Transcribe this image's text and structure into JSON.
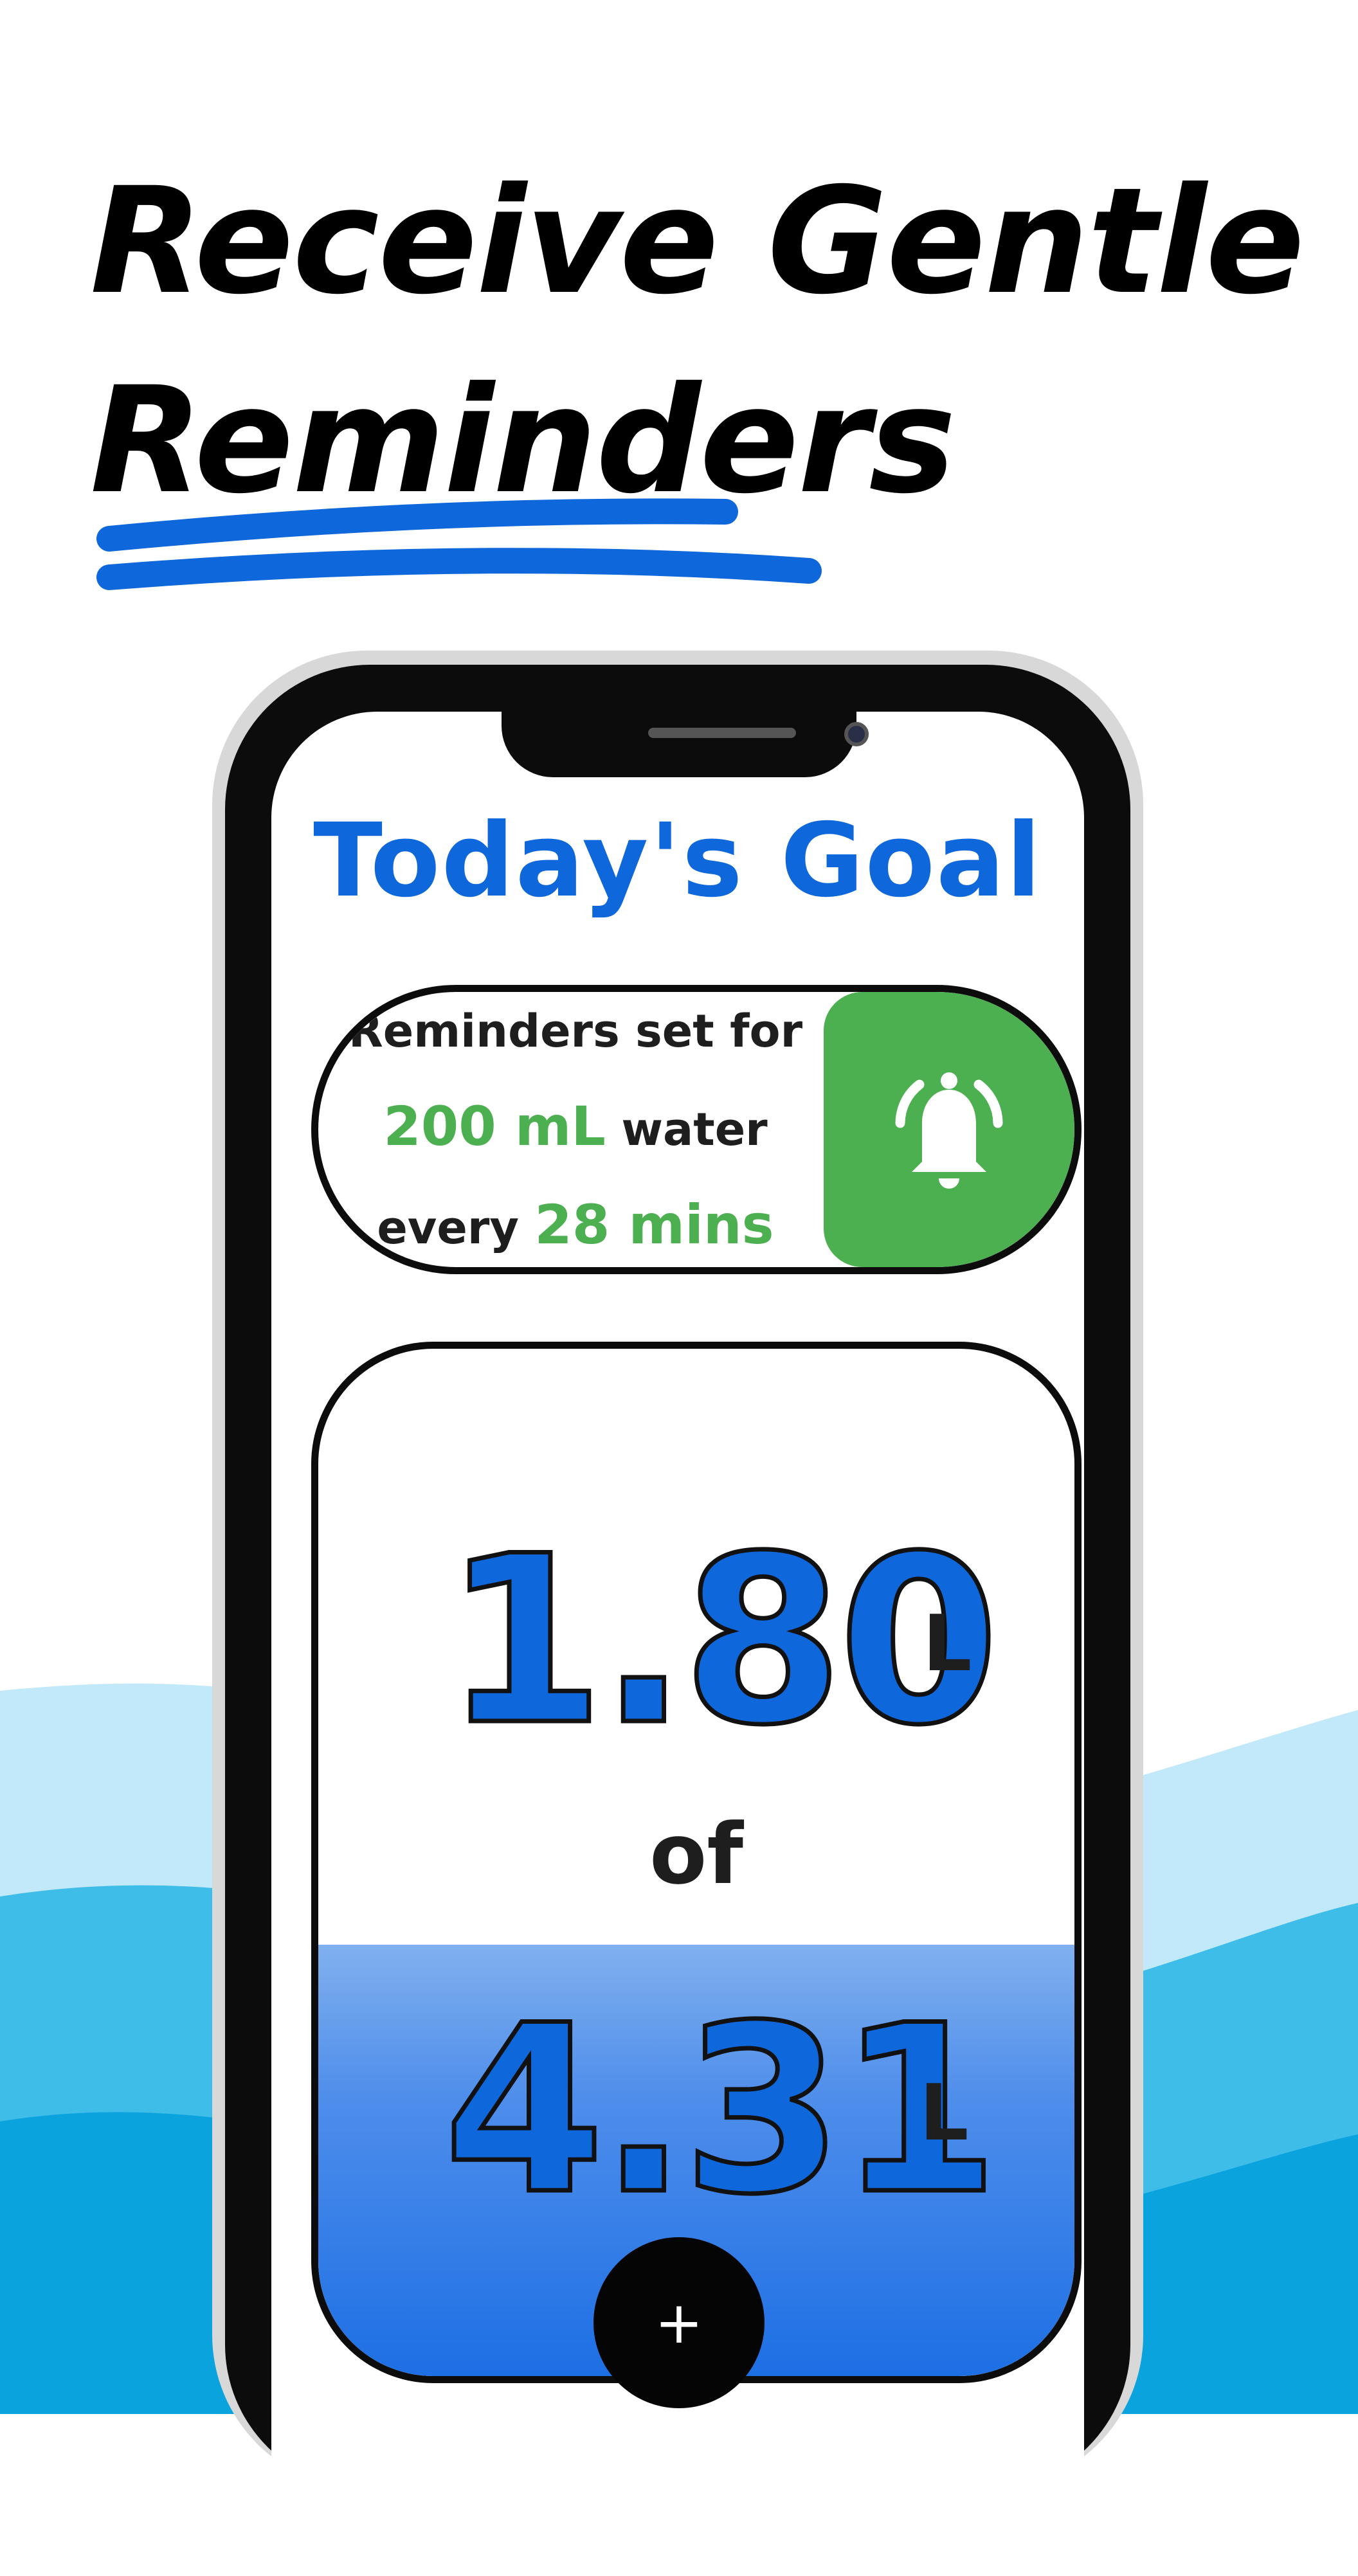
{
  "headline": {
    "line1": "Receive Gentle",
    "line2": "Reminders"
  },
  "colors": {
    "accent": "#0f67dc",
    "green": "#4caf50",
    "phone": "#0c0c0c"
  },
  "screen": {
    "title": "Today's Goal",
    "reminder": {
      "line1": "Reminders set for",
      "amount": "200 mL",
      "amount_suffix": " water",
      "interval_prefix": "every ",
      "interval": "28 mins",
      "icon": "bell-icon"
    },
    "progress": {
      "current": "1.80",
      "current_unit": "L",
      "of_label": "of",
      "goal": "4.31",
      "goal_unit": "L",
      "fill_fraction": 0.42
    },
    "add_button": {
      "label": "+",
      "icon": "plus-icon"
    }
  }
}
